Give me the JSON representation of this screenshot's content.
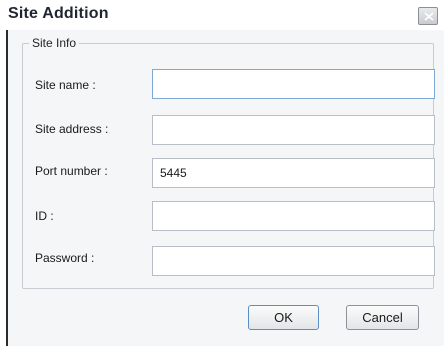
{
  "window": {
    "title": "Site Addition",
    "close_icon": "close-icon"
  },
  "groupbox": {
    "legend": "Site Info"
  },
  "form": {
    "site_name": {
      "label": "Site name :",
      "value": ""
    },
    "site_address": {
      "label": "Site address :",
      "value": ""
    },
    "port_number": {
      "label": "Port number :",
      "value": "5445"
    },
    "id": {
      "label": "ID :",
      "value": ""
    },
    "password": {
      "label": "Password :",
      "value": ""
    }
  },
  "buttons": {
    "ok": "OK",
    "cancel": "Cancel"
  }
}
